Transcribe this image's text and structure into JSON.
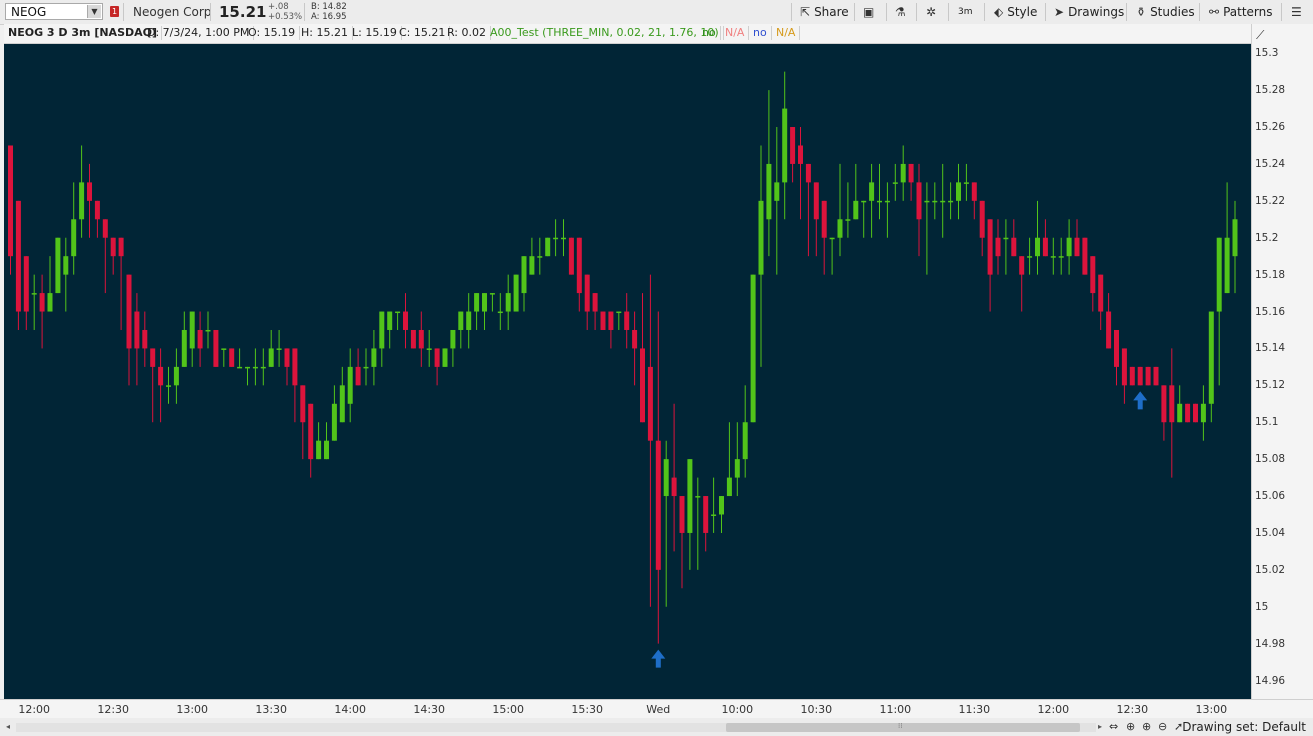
{
  "toolbar": {
    "symbol": "NEOG",
    "alert_count": "1",
    "company": "Neogen Corp",
    "last_price": "15.21",
    "change": "+.08",
    "change_pct": "+0.53%",
    "bid": "B: 14.82",
    "ask": "A: 16.95",
    "share_label": "Share",
    "style_label": "Style",
    "drawings_label": "Drawings",
    "studies_label": "Studies",
    "patterns_label": "Patterns",
    "timeframe_label": "3m"
  },
  "legend": {
    "title": "NEOG 3 D 3m [NASDAQ]",
    "date": "D: 7/3/24, 1:00 PM",
    "open": "O: 15.19",
    "high": "H: 15.21",
    "low": "L: 15.19",
    "close": "C: 15.21",
    "range": "R: 0.02",
    "study": "A00_Test (THREE_MIN, 0.02, 21, 1.76, 10)",
    "v1": "no",
    "v2": "N/A",
    "v3": "no",
    "v4": "N/A",
    "colors": {
      "study": "#3a9a1d",
      "v1": "#2f8f1f",
      "v2": "#f08080",
      "v3": "#3050d0",
      "v4": "#d69a1a"
    }
  },
  "status": {
    "drawing_set": "Drawing set: Default"
  },
  "chart_data": {
    "type": "candlestick",
    "colors": {
      "background": "#012536",
      "up": "#52c41a",
      "down": "#dc143c",
      "arrow": "#1e6ec8"
    },
    "y_ticks": [
      "15.3",
      "15.28",
      "15.26",
      "15.24",
      "15.22",
      "15.2",
      "15.18",
      "15.16",
      "15.14",
      "15.12",
      "15.1",
      "15.08",
      "15.06",
      "15.04",
      "15.02",
      "15",
      "14.98",
      "14.96"
    ],
    "x_ticks": [
      "12:00",
      "12:30",
      "13:00",
      "13:30",
      "14:00",
      "14:30",
      "15:00",
      "15:30",
      "Wed",
      "10:00",
      "10:30",
      "11:00",
      "11:30",
      "12:00",
      "12:30",
      "13:00"
    ],
    "ylim": [
      14.95,
      15.305
    ],
    "candles": [
      [
        15.25,
        15.25,
        15.18,
        15.19
      ],
      [
        15.22,
        15.22,
        15.15,
        15.16
      ],
      [
        15.19,
        15.19,
        15.15,
        15.16
      ],
      [
        15.17,
        15.18,
        15.15,
        15.17
      ],
      [
        15.17,
        15.18,
        15.14,
        15.16
      ],
      [
        15.16,
        15.19,
        15.16,
        15.17
      ],
      [
        15.17,
        15.2,
        15.17,
        15.2
      ],
      [
        15.18,
        15.2,
        15.16,
        15.19
      ],
      [
        15.19,
        15.23,
        15.18,
        15.21
      ],
      [
        15.21,
        15.25,
        15.2,
        15.23
      ],
      [
        15.23,
        15.24,
        15.2,
        15.22
      ],
      [
        15.22,
        15.22,
        15.2,
        15.21
      ],
      [
        15.21,
        15.21,
        15.17,
        15.2
      ],
      [
        15.2,
        15.2,
        15.18,
        15.19
      ],
      [
        15.2,
        15.2,
        15.15,
        15.19
      ],
      [
        15.18,
        15.18,
        15.12,
        15.14
      ],
      [
        15.16,
        15.17,
        15.12,
        15.14
      ],
      [
        15.15,
        15.16,
        15.13,
        15.14
      ],
      [
        15.14,
        15.14,
        15.1,
        15.13
      ],
      [
        15.13,
        15.14,
        15.1,
        15.12
      ],
      [
        15.12,
        15.13,
        15.11,
        15.12
      ],
      [
        15.12,
        15.14,
        15.11,
        15.13
      ],
      [
        15.13,
        15.16,
        15.13,
        15.15
      ],
      [
        15.14,
        15.16,
        15.13,
        15.16
      ],
      [
        15.15,
        15.16,
        15.13,
        15.14
      ],
      [
        15.15,
        15.16,
        15.14,
        15.15
      ],
      [
        15.15,
        15.15,
        15.13,
        15.13
      ],
      [
        15.14,
        15.14,
        15.13,
        15.14
      ],
      [
        15.14,
        15.14,
        15.13,
        15.13
      ],
      [
        15.13,
        15.14,
        15.13,
        15.13
      ],
      [
        15.13,
        15.13,
        15.12,
        15.13
      ],
      [
        15.13,
        15.14,
        15.12,
        15.13
      ],
      [
        15.13,
        15.14,
        15.12,
        15.13
      ],
      [
        15.13,
        15.15,
        15.13,
        15.14
      ],
      [
        15.14,
        15.15,
        15.13,
        15.14
      ],
      [
        15.14,
        15.14,
        15.12,
        15.13
      ],
      [
        15.14,
        15.14,
        15.1,
        15.12
      ],
      [
        15.12,
        15.12,
        15.08,
        15.1
      ],
      [
        15.11,
        15.11,
        15.07,
        15.08
      ],
      [
        15.08,
        15.1,
        15.08,
        15.09
      ],
      [
        15.08,
        15.1,
        15.08,
        15.09
      ],
      [
        15.09,
        15.12,
        15.09,
        15.11
      ],
      [
        15.1,
        15.13,
        15.1,
        15.12
      ],
      [
        15.11,
        15.14,
        15.1,
        15.13
      ],
      [
        15.13,
        15.14,
        15.12,
        15.12
      ],
      [
        15.13,
        15.14,
        15.12,
        15.13
      ],
      [
        15.13,
        15.15,
        15.12,
        15.14
      ],
      [
        15.14,
        15.16,
        15.13,
        15.16
      ],
      [
        15.15,
        15.16,
        15.14,
        15.16
      ],
      [
        15.16,
        15.16,
        15.15,
        15.16
      ],
      [
        15.16,
        15.17,
        15.14,
        15.15
      ],
      [
        15.15,
        15.15,
        15.14,
        15.14
      ],
      [
        15.15,
        15.16,
        15.13,
        15.14
      ],
      [
        15.14,
        15.15,
        15.13,
        15.14
      ],
      [
        15.14,
        15.14,
        15.12,
        15.13
      ],
      [
        15.13,
        15.14,
        15.13,
        15.14
      ],
      [
        15.14,
        15.15,
        15.13,
        15.15
      ],
      [
        15.15,
        15.16,
        15.14,
        15.16
      ],
      [
        15.15,
        15.17,
        15.14,
        15.16
      ],
      [
        15.16,
        15.17,
        15.15,
        15.17
      ],
      [
        15.16,
        15.17,
        15.15,
        15.17
      ],
      [
        15.17,
        15.17,
        15.16,
        15.17
      ],
      [
        15.16,
        15.17,
        15.15,
        15.16
      ],
      [
        15.16,
        15.18,
        15.15,
        15.17
      ],
      [
        15.16,
        15.18,
        15.16,
        15.18
      ],
      [
        15.17,
        15.19,
        15.16,
        15.19
      ],
      [
        15.18,
        15.2,
        15.18,
        15.19
      ],
      [
        15.19,
        15.2,
        15.18,
        15.19
      ],
      [
        15.19,
        15.2,
        15.19,
        15.2
      ],
      [
        15.2,
        15.21,
        15.19,
        15.2
      ],
      [
        15.2,
        15.21,
        15.19,
        15.2
      ],
      [
        15.2,
        15.2,
        15.18,
        15.18
      ],
      [
        15.2,
        15.2,
        15.16,
        15.17
      ],
      [
        15.18,
        15.18,
        15.15,
        15.16
      ],
      [
        15.17,
        15.17,
        15.15,
        15.16
      ],
      [
        15.16,
        15.16,
        15.15,
        15.15
      ],
      [
        15.16,
        15.16,
        15.14,
        15.15
      ],
      [
        15.16,
        15.16,
        15.15,
        15.16
      ],
      [
        15.16,
        15.17,
        15.14,
        15.15
      ],
      [
        15.15,
        15.16,
        15.12,
        15.14
      ],
      [
        15.14,
        15.17,
        15.1,
        15.1
      ],
      [
        15.13,
        15.18,
        15.0,
        15.09
      ],
      [
        15.09,
        15.16,
        14.98,
        15.02
      ],
      [
        15.06,
        15.09,
        15.0,
        15.08
      ],
      [
        15.07,
        15.11,
        15.03,
        15.06
      ],
      [
        15.06,
        15.06,
        15.01,
        15.04
      ],
      [
        15.04,
        15.08,
        15.02,
        15.08
      ],
      [
        15.06,
        15.07,
        15.02,
        15.06
      ],
      [
        15.06,
        15.06,
        15.03,
        15.04
      ],
      [
        15.05,
        15.07,
        15.04,
        15.05
      ],
      [
        15.05,
        15.06,
        15.04,
        15.06
      ],
      [
        15.06,
        15.1,
        15.06,
        15.07
      ],
      [
        15.07,
        15.1,
        15.06,
        15.08
      ],
      [
        15.08,
        15.12,
        15.07,
        15.1
      ],
      [
        15.1,
        15.18,
        15.1,
        15.18
      ],
      [
        15.18,
        15.25,
        15.13,
        15.22
      ],
      [
        15.21,
        15.28,
        15.19,
        15.24
      ],
      [
        15.22,
        15.26,
        15.18,
        15.23
      ],
      [
        15.23,
        15.29,
        15.21,
        15.27
      ],
      [
        15.26,
        15.26,
        15.23,
        15.24
      ],
      [
        15.25,
        15.26,
        15.21,
        15.24
      ],
      [
        15.24,
        15.24,
        15.19,
        15.23
      ],
      [
        15.23,
        15.23,
        15.19,
        15.21
      ],
      [
        15.22,
        15.22,
        15.18,
        15.2
      ],
      [
        15.2,
        15.2,
        15.18,
        15.2
      ],
      [
        15.2,
        15.24,
        15.19,
        15.21
      ],
      [
        15.21,
        15.23,
        15.2,
        15.21
      ],
      [
        15.21,
        15.24,
        15.21,
        15.22
      ],
      [
        15.22,
        15.22,
        15.2,
        15.22
      ],
      [
        15.22,
        15.24,
        15.2,
        15.23
      ],
      [
        15.22,
        15.24,
        15.21,
        15.22
      ],
      [
        15.22,
        15.23,
        15.2,
        15.22
      ],
      [
        15.23,
        15.24,
        15.22,
        15.23
      ],
      [
        15.23,
        15.25,
        15.22,
        15.24
      ],
      [
        15.24,
        15.24,
        15.22,
        15.23
      ],
      [
        15.23,
        15.24,
        15.19,
        15.21
      ],
      [
        15.22,
        15.23,
        15.18,
        15.22
      ],
      [
        15.22,
        15.23,
        15.21,
        15.22
      ],
      [
        15.22,
        15.24,
        15.2,
        15.22
      ],
      [
        15.22,
        15.23,
        15.21,
        15.22
      ],
      [
        15.22,
        15.24,
        15.21,
        15.23
      ],
      [
        15.23,
        15.24,
        15.22,
        15.23
      ],
      [
        15.23,
        15.23,
        15.21,
        15.22
      ],
      [
        15.22,
        15.22,
        15.19,
        15.2
      ],
      [
        15.21,
        15.21,
        15.16,
        15.18
      ],
      [
        15.2,
        15.21,
        15.18,
        15.19
      ],
      [
        15.2,
        15.21,
        15.18,
        15.2
      ],
      [
        15.2,
        15.21,
        15.19,
        15.19
      ],
      [
        15.19,
        15.19,
        15.16,
        15.18
      ],
      [
        15.19,
        15.2,
        15.18,
        15.19
      ],
      [
        15.19,
        15.22,
        15.18,
        15.2
      ],
      [
        15.2,
        15.21,
        15.19,
        15.19
      ],
      [
        15.19,
        15.2,
        15.18,
        15.19
      ],
      [
        15.19,
        15.2,
        15.18,
        15.19
      ],
      [
        15.19,
        15.21,
        15.18,
        15.2
      ],
      [
        15.2,
        15.21,
        15.19,
        15.19
      ],
      [
        15.2,
        15.2,
        15.18,
        15.18
      ],
      [
        15.19,
        15.19,
        15.16,
        15.17
      ],
      [
        15.18,
        15.18,
        15.15,
        15.16
      ],
      [
        15.16,
        15.17,
        15.14,
        15.14
      ],
      [
        15.15,
        15.15,
        15.12,
        15.13
      ],
      [
        15.14,
        15.14,
        15.11,
        15.12
      ],
      [
        15.13,
        15.13,
        15.12,
        15.12
      ],
      [
        15.13,
        15.13,
        15.12,
        15.12
      ],
      [
        15.13,
        15.13,
        15.12,
        15.12
      ],
      [
        15.13,
        15.13,
        15.12,
        15.12
      ],
      [
        15.12,
        15.12,
        15.09,
        15.1
      ],
      [
        15.12,
        15.14,
        15.07,
        15.1
      ],
      [
        15.1,
        15.12,
        15.1,
        15.11
      ],
      [
        15.11,
        15.11,
        15.1,
        15.1
      ],
      [
        15.11,
        15.11,
        15.1,
        15.1
      ],
      [
        15.1,
        15.12,
        15.09,
        15.11
      ],
      [
        15.11,
        15.14,
        15.1,
        15.16
      ],
      [
        15.16,
        15.2,
        15.12,
        15.2
      ],
      [
        15.17,
        15.23,
        15.17,
        15.2
      ],
      [
        15.19,
        15.22,
        15.17,
        15.21
      ]
    ],
    "up_arrows": [
      82,
      143
    ]
  }
}
